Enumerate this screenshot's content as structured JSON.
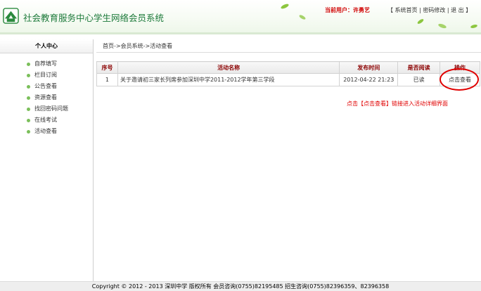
{
  "header": {
    "site_title": "社会教育服务中心学生网络会员系统",
    "current_user_label": "当前用户：许勇艺",
    "links": [
      "【 系统首页",
      "密码修改",
      "退 出 】"
    ]
  },
  "sidebar": {
    "title": "个人中心",
    "items": [
      "自荐填写",
      "栏目订阅",
      "公告查看",
      "资源查看",
      "找回密码问题",
      "在线考试",
      "活动查看"
    ]
  },
  "breadcrumb": "首页->会员系统->活动查看",
  "table": {
    "headers": [
      "序号",
      "活动名称",
      "发布时间",
      "是否阅读",
      "操作"
    ],
    "rows": [
      {
        "index": "1",
        "name": "关于邀请初三家长列席参加深圳中学2011-2012学年第三学段",
        "time": "2012-04-22 21:23",
        "status": "已读",
        "action": "点击查看"
      }
    ]
  },
  "hint": "点击【点击查看】链接进入活动详细界面",
  "footer": "Copyright © 2012 - 2013 深圳中学 版权所有  会员咨询(0755)82195485  招生咨询(0755)82396359、82396358",
  "colors": {
    "brand_green": "#1c7a3a",
    "alert_red": "#e00000",
    "header_red": "#8b0000"
  }
}
